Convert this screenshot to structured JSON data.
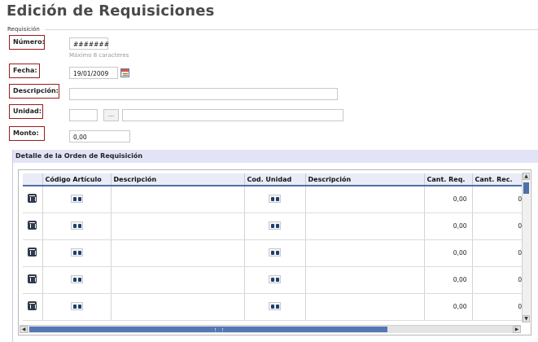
{
  "page": {
    "title": "Edición de Requisiciones"
  },
  "fieldset": {
    "legend": "Requisición"
  },
  "form": {
    "numero": {
      "label": "Número:",
      "value": "#######",
      "hint": "Máximo 8 caracteres"
    },
    "fecha": {
      "label": "Fecha:",
      "value": "19/01/2009"
    },
    "descripcion": {
      "label": "Descripción:",
      "value": ""
    },
    "unidad": {
      "label": "Unidad:",
      "code_value": "",
      "lookup_label": "...",
      "name_value": ""
    },
    "monto": {
      "label": "Monto:",
      "value": "0,00"
    }
  },
  "detail": {
    "title": "Detalle de la Orden de Requisición",
    "columns": [
      "",
      "Código Artículo",
      "Descripción",
      "Cod. Unidad",
      "Descripción",
      "Cant. Req.",
      "Cant. Rec."
    ],
    "rows": [
      {
        "codigo": "",
        "descripcion": "",
        "cod_unidad": "",
        "descripcion_unidad": "",
        "cant_req": "0,00",
        "cant_rec": "0,"
      },
      {
        "codigo": "",
        "descripcion": "",
        "cod_unidad": "",
        "descripcion_unidad": "",
        "cant_req": "0,00",
        "cant_rec": "0,"
      },
      {
        "codigo": "",
        "descripcion": "",
        "cod_unidad": "",
        "descripcion_unidad": "",
        "cant_req": "0,00",
        "cant_rec": "0,"
      },
      {
        "codigo": "",
        "descripcion": "",
        "cod_unidad": "",
        "descripcion_unidad": "",
        "cant_req": "0,00",
        "cant_rec": "0,"
      },
      {
        "codigo": "",
        "descripcion": "",
        "cod_unidad": "",
        "descripcion_unidad": "",
        "cant_req": "0,00",
        "cant_rec": "0,"
      }
    ],
    "icons": {
      "delete": "trash-icon",
      "search": "binoculars-icon"
    }
  },
  "colors": {
    "label_border": "#9a1b1b",
    "header_bg": "#e2e3f7",
    "accent": "#4f6fa8"
  }
}
